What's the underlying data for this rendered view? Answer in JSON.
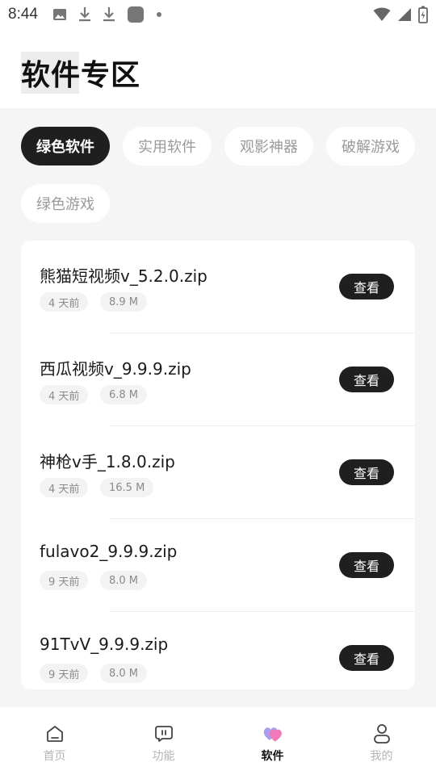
{
  "status_bar": {
    "time": "8:44",
    "left_icons": [
      "image-icon",
      "download-icon",
      "download-icon",
      "app-icon",
      "dot-icon"
    ],
    "right_icons": [
      "wifi-icon",
      "signal-icon",
      "battery-charging-icon"
    ]
  },
  "header": {
    "title": "软件专区"
  },
  "categories": [
    {
      "label": "绿色软件",
      "active": true
    },
    {
      "label": "实用软件",
      "active": false
    },
    {
      "label": "观影神器",
      "active": false
    },
    {
      "label": "破解游戏",
      "active": false
    },
    {
      "label": "绿色游戏",
      "active": false
    }
  ],
  "files": [
    {
      "name": "熊猫短视频v_5.2.0.zip",
      "time": "4 天前",
      "size": "8.9 M",
      "action": "查看"
    },
    {
      "name": "西瓜视频v_9.9.9.zip",
      "time": "4 天前",
      "size": "6.8 M",
      "action": "查看"
    },
    {
      "name": "神枪v手_1.8.0.zip",
      "time": "4 天前",
      "size": "16.5 M",
      "action": "查看"
    },
    {
      "name": "fulavo2_9.9.9.zip",
      "time": "9 天前",
      "size": "8.0 M",
      "action": "查看"
    },
    {
      "name": "91TvV_9.9.9.zip",
      "time": "9 天前",
      "size": "8.0 M",
      "action": "查看"
    }
  ],
  "bottom_nav": [
    {
      "label": "首页",
      "icon": "home-icon",
      "active": false
    },
    {
      "label": "功能",
      "icon": "chat-icon",
      "active": false
    },
    {
      "label": "软件",
      "icon": "hearts-icon",
      "active": true
    },
    {
      "label": "我的",
      "icon": "user-icon",
      "active": false
    }
  ],
  "colors": {
    "accent": "#1f1f1f",
    "background": "#f5f5f6",
    "card": "#ffffff",
    "inactive_text": "#9a9a9a",
    "nav_active_icon": "#e85aa6"
  }
}
